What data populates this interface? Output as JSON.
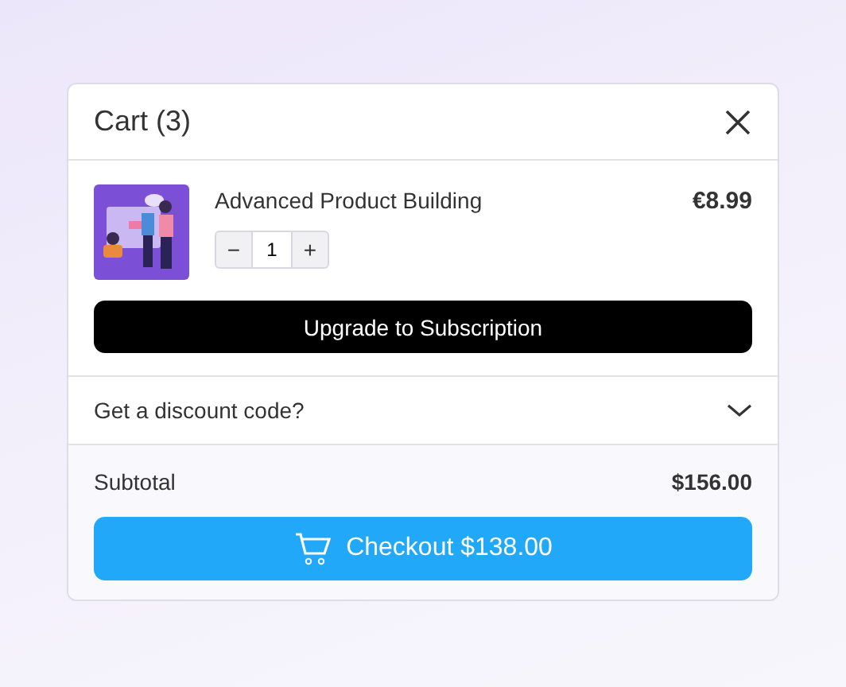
{
  "cart": {
    "title": "Cart (3)",
    "items": [
      {
        "kind": "picture",
        "name": "Advanced Product Building",
        "price": "€8.99",
        "quantity": "1",
        "decrease": "−",
        "increase": "+"
      }
    ],
    "upgrade_button": "Upgrade to Subscription",
    "discount": {
      "label": "Get a discount code?",
      "expanded": false
    },
    "subtotal": {
      "label": "Subtotal",
      "value": "$156.00"
    },
    "checkout_button": "Checkout $138.00"
  }
}
